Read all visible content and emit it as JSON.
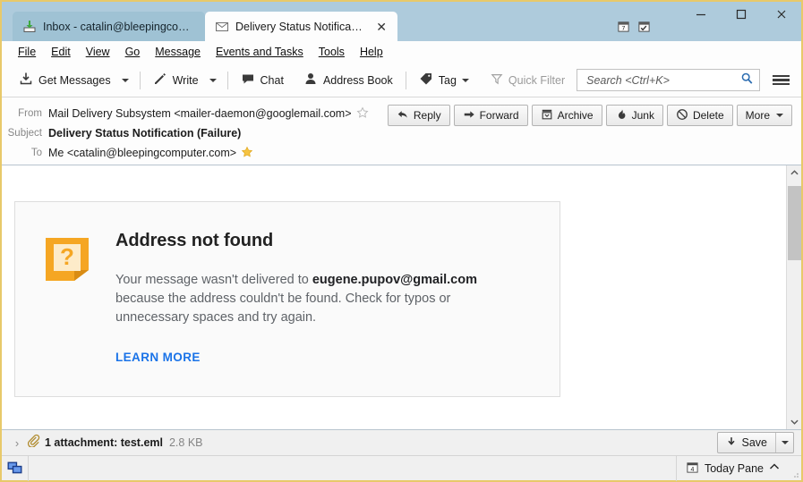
{
  "window": {
    "frame_color": "#e8c96a",
    "titlebar_color": "#aecbdc",
    "controls": {
      "minimize": "minimize-button",
      "maximize": "maximize-button",
      "close": "close-button"
    },
    "mini_icons": [
      {
        "name": "calendar-icon",
        "label": "Calendar"
      },
      {
        "name": "tasks-icon",
        "label": "Tasks"
      }
    ]
  },
  "tabs": [
    {
      "label": "Inbox - catalin@bleepingcom...",
      "icon": "inbox-icon",
      "active": false,
      "closeable": false
    },
    {
      "label": "Delivery Status Notificatio...",
      "icon": "envelope-icon",
      "active": true,
      "closeable": true,
      "close_label": "✕"
    }
  ],
  "menubar": [
    {
      "label": "File",
      "accel": "F"
    },
    {
      "label": "Edit",
      "accel": "E"
    },
    {
      "label": "View",
      "accel": "V"
    },
    {
      "label": "Go",
      "accel": "G"
    },
    {
      "label": "Message",
      "accel": "M"
    },
    {
      "label": "Events and Tasks",
      "accel": "n"
    },
    {
      "label": "Tools",
      "accel": "T"
    },
    {
      "label": "Help",
      "accel": "H"
    }
  ],
  "toolbar": {
    "get_messages": "Get Messages",
    "write": "Write",
    "chat": "Chat",
    "address_book": "Address Book",
    "tag": "Tag",
    "quick_filter": "Quick Filter",
    "search_placeholder": "Search <Ctrl+K>",
    "search_value": ""
  },
  "message_header": {
    "from_label": "From",
    "from_value": "Mail Delivery Subsystem <mailer-daemon@googlemail.com>",
    "from_starred": false,
    "subject_label": "Subject",
    "subject_value": "Delivery Status Notification (Failure)",
    "to_label": "To",
    "to_value": "Me <catalin@bleepingcomputer.com>",
    "to_starred": true
  },
  "actions": [
    {
      "label": "Reply",
      "icon": "reply-arrow-icon"
    },
    {
      "label": "Forward",
      "icon": "forward-arrow-icon"
    },
    {
      "label": "Archive",
      "icon": "archive-box-icon"
    },
    {
      "label": "Junk",
      "icon": "junk-flame-icon"
    },
    {
      "label": "Delete",
      "icon": "delete-prohibition-icon"
    },
    {
      "label": "More",
      "icon": "chevron-down-icon"
    }
  ],
  "message_body": {
    "icon": "orange-question-note-icon",
    "icon_color": "#f5a623",
    "title": "Address not found",
    "text_before": "Your message wasn't delivered to ",
    "recipient": "eugene.pupov@gmail.com",
    "text_after": " because the address couldn't be found. Check for typos or unnecessary spaces and try again.",
    "link_label": "LEARN MORE",
    "link_color": "#1a73e8"
  },
  "attachment_bar": {
    "expander": "›",
    "label": "1 attachment: test.eml",
    "size": "2.8 KB",
    "save_label": "Save"
  },
  "statusbar": {
    "connection_icon": "network-status-icon",
    "today_pane_label": "Today Pane",
    "today_pane_icon": "calendar-4-icon",
    "today_pane_chevron": "⌃"
  }
}
